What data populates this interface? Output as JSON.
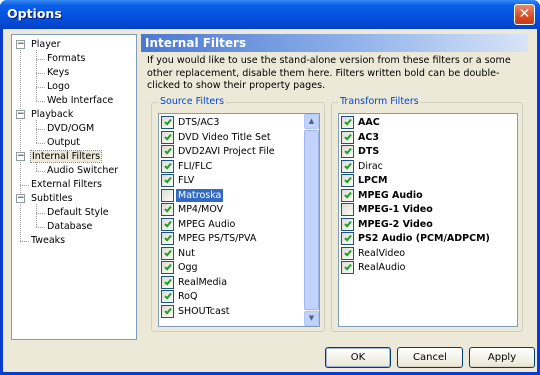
{
  "window": {
    "title": "Options",
    "close_glyph": "✕"
  },
  "tree": [
    {
      "label": "Player",
      "level": 0,
      "expander": "−"
    },
    {
      "label": "Formats",
      "level": 1
    },
    {
      "label": "Keys",
      "level": 1
    },
    {
      "label": "Logo",
      "level": 1
    },
    {
      "label": "Web Interface",
      "level": 1
    },
    {
      "label": "Playback",
      "level": 0,
      "expander": "−"
    },
    {
      "label": "DVD/OGM",
      "level": 1
    },
    {
      "label": "Output",
      "level": 1
    },
    {
      "label": "Internal Filters",
      "level": 0,
      "expander": "−",
      "selected": true
    },
    {
      "label": "Audio Switcher",
      "level": 1
    },
    {
      "label": "External Filters",
      "level": 0
    },
    {
      "label": "Subtitles",
      "level": 0,
      "expander": "−"
    },
    {
      "label": "Default Style",
      "level": 1
    },
    {
      "label": "Database",
      "level": 1
    },
    {
      "label": "Tweaks",
      "level": 0
    }
  ],
  "page": {
    "header": "Internal Filters",
    "description": "If you would like to use the stand-alone version from these filters or a some other replacement, disable them here. Filters written bold can be double-clicked to show their property pages."
  },
  "source_filters": {
    "label": "Source Filters",
    "items": [
      {
        "label": "DTS/AC3",
        "checked": true
      },
      {
        "label": "DVD Video Title Set",
        "checked": true
      },
      {
        "label": "DVD2AVI Project File",
        "checked": true
      },
      {
        "label": "FLI/FLC",
        "checked": true
      },
      {
        "label": "FLV",
        "checked": true
      },
      {
        "label": "Matroska",
        "checked": false,
        "selected": true
      },
      {
        "label": "MP4/MOV",
        "checked": true
      },
      {
        "label": "MPEG Audio",
        "checked": true
      },
      {
        "label": "MPEG PS/TS/PVA",
        "checked": true
      },
      {
        "label": "Nut",
        "checked": true
      },
      {
        "label": "Ogg",
        "checked": true
      },
      {
        "label": "RealMedia",
        "checked": true
      },
      {
        "label": "RoQ",
        "checked": true
      },
      {
        "label": "SHOUTcast",
        "checked": true
      }
    ]
  },
  "transform_filters": {
    "label": "Transform Filters",
    "items": [
      {
        "label": "AAC",
        "checked": true,
        "bold": true
      },
      {
        "label": "AC3",
        "checked": true,
        "bold": true
      },
      {
        "label": "DTS",
        "checked": true,
        "bold": true
      },
      {
        "label": "Dirac",
        "checked": true,
        "bold": false
      },
      {
        "label": "LPCM",
        "checked": true,
        "bold": true
      },
      {
        "label": "MPEG Audio",
        "checked": true,
        "bold": true
      },
      {
        "label": "MPEG-1 Video",
        "checked": false,
        "bold": true
      },
      {
        "label": "MPEG-2 Video",
        "checked": true,
        "bold": true
      },
      {
        "label": "PS2 Audio (PCM/ADPCM)",
        "checked": true,
        "bold": true
      },
      {
        "label": "RealVideo",
        "checked": true,
        "bold": false
      },
      {
        "label": "RealAudio",
        "checked": true,
        "bold": false
      }
    ]
  },
  "buttons": {
    "ok": "OK",
    "cancel": "Cancel",
    "apply": "Apply"
  },
  "colors": {
    "titlebar": "#0454e2",
    "selection": "#316ac5",
    "group_label": "#0046d5",
    "face": "#ece9d8"
  }
}
